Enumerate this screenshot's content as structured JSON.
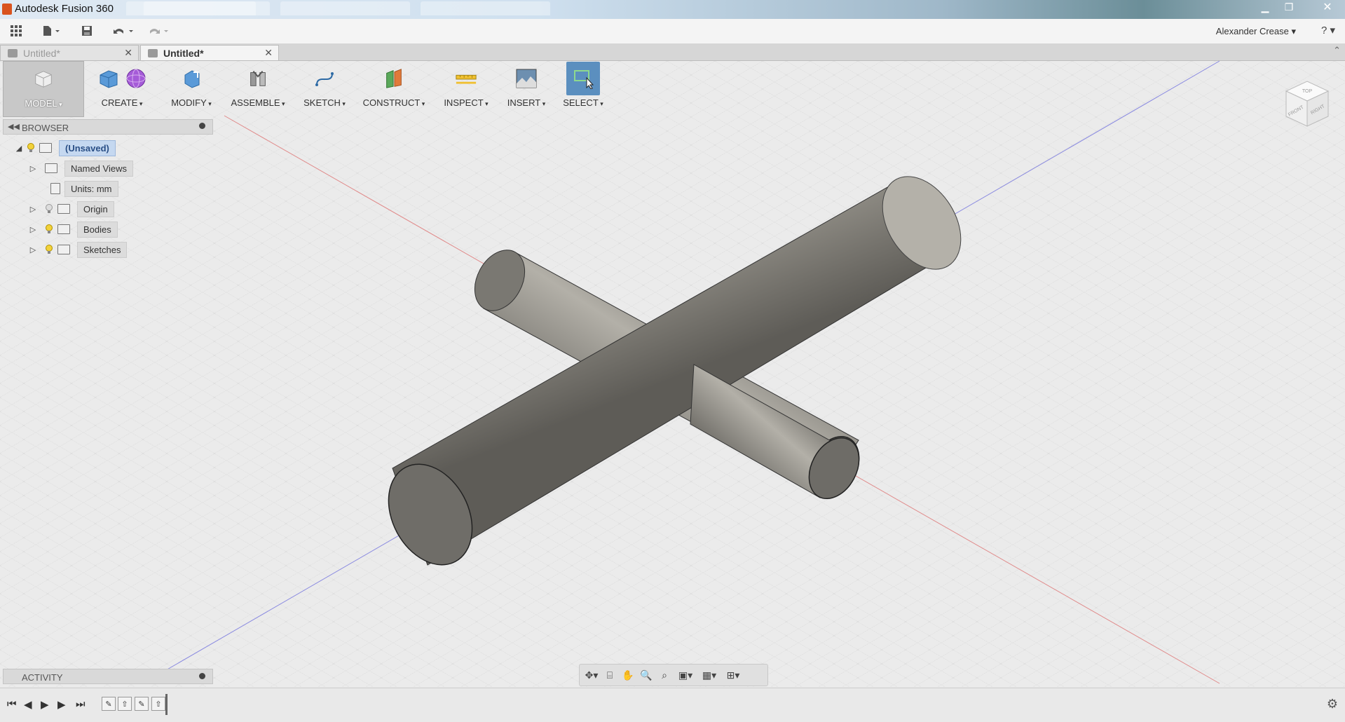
{
  "window": {
    "title": "Autodesk Fusion 360",
    "controls": [
      "minimize",
      "restore",
      "close"
    ]
  },
  "quick_access": {
    "buttons": [
      "app-grid-icon",
      "file-icon",
      "save-icon",
      "undo-icon",
      "redo-icon"
    ],
    "user": "Alexander Crease ▾",
    "help": "? ▾"
  },
  "doc_tabs": [
    {
      "label": "Untitled*",
      "active": false
    },
    {
      "label": "Untitled*",
      "active": true
    }
  ],
  "toolbar": {
    "model": "MODEL",
    "create": "CREATE",
    "modify": "MODIFY",
    "assemble": "ASSEMBLE",
    "sketch": "SKETCH",
    "construct": "CONSTRUCT",
    "inspect": "INSPECT",
    "insert": "INSERT",
    "select": "SELECT"
  },
  "browser": {
    "title": "BROWSER",
    "root": "(Unsaved)",
    "items": [
      {
        "label": "Named Views"
      },
      {
        "label": "Units: mm"
      },
      {
        "label": "Origin"
      },
      {
        "label": "Bodies"
      },
      {
        "label": "Sketches"
      }
    ]
  },
  "activity": {
    "title": "ACTIVITY"
  },
  "viewcube": {
    "top": "TOP",
    "front": "FRONT",
    "right": "RIGHT"
  },
  "colors": {
    "accent": "#3d6fa5",
    "select_active": "#5b8fbf",
    "metal": "#8a8780",
    "x_axis": "#e07070",
    "z_axis": "#7070e0"
  }
}
